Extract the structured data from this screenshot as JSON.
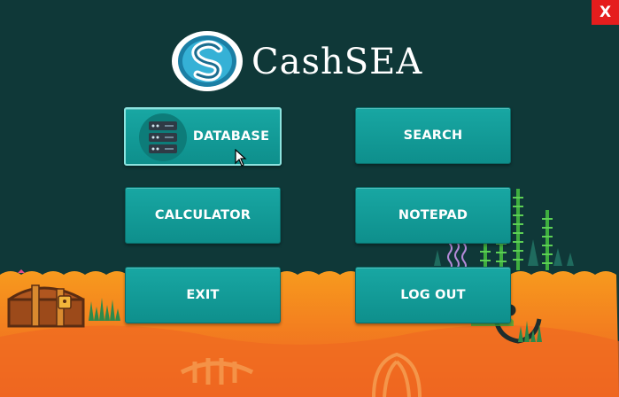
{
  "window": {
    "close_label": "X"
  },
  "header": {
    "brand": "CashSEA",
    "logo_icon": "cashsea-logo-icon"
  },
  "menu": {
    "database": "DATABASE",
    "search": "SEARCH",
    "calculator": "CALCULATOR",
    "notepad": "NOTEPAD",
    "exit": "EXIT",
    "logout": "LOG OUT"
  },
  "colors": {
    "background": "#0f3838",
    "button": "#14a09c",
    "sand": "#f47a20",
    "close": "#e51d1d"
  }
}
